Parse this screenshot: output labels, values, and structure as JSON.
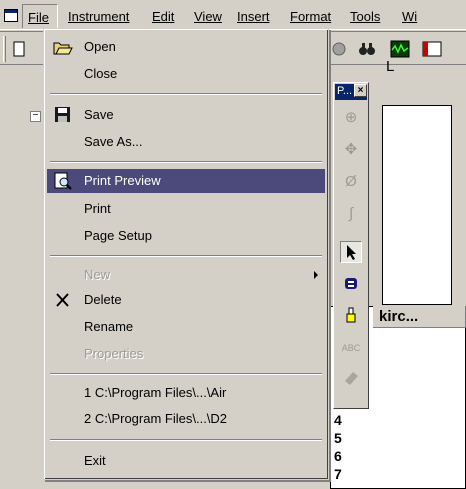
{
  "menubar": {
    "items": [
      {
        "label": "File"
      },
      {
        "label": "Instrument"
      },
      {
        "label": "Edit"
      },
      {
        "label": "View"
      },
      {
        "label": "Insert"
      },
      {
        "label": "Format"
      },
      {
        "label": "Tools"
      },
      {
        "label": "Wi"
      }
    ]
  },
  "palette": {
    "title": "P...",
    "close": "×",
    "tools": [
      "zoom-in",
      "pan",
      "measure",
      "curve",
      "pointer",
      "scale",
      "marker",
      "text-abc",
      "eraser"
    ]
  },
  "document": {
    "letter": "L"
  },
  "grid": {
    "header": "kirc...",
    "rows": [
      "4",
      "5",
      "6",
      "7"
    ]
  },
  "file_menu": {
    "items": [
      {
        "label": "Open",
        "icon": "open-folder-icon"
      },
      {
        "label": "Close"
      },
      {
        "label": "Save",
        "icon": "floppy-disk-icon"
      },
      {
        "label": "Save As..."
      },
      {
        "label": "Print Preview",
        "icon": "print-preview-icon",
        "highlighted": true
      },
      {
        "label": "Print"
      },
      {
        "label": "Page Setup"
      },
      {
        "label": "New",
        "disabled": true,
        "submenu": true
      },
      {
        "label": "Delete",
        "icon": "delete-x-icon"
      },
      {
        "label": "Rename"
      },
      {
        "label": "Properties",
        "disabled": true
      },
      {
        "label": "1 C:\\Program Files\\...\\Air"
      },
      {
        "label": "2 C:\\Program Files\\...\\D2"
      },
      {
        "label": "Exit"
      }
    ]
  },
  "colors": {
    "highlight": "#4b4a7a",
    "titlebar": "#0a246a",
    "face": "#d4d0c8"
  }
}
